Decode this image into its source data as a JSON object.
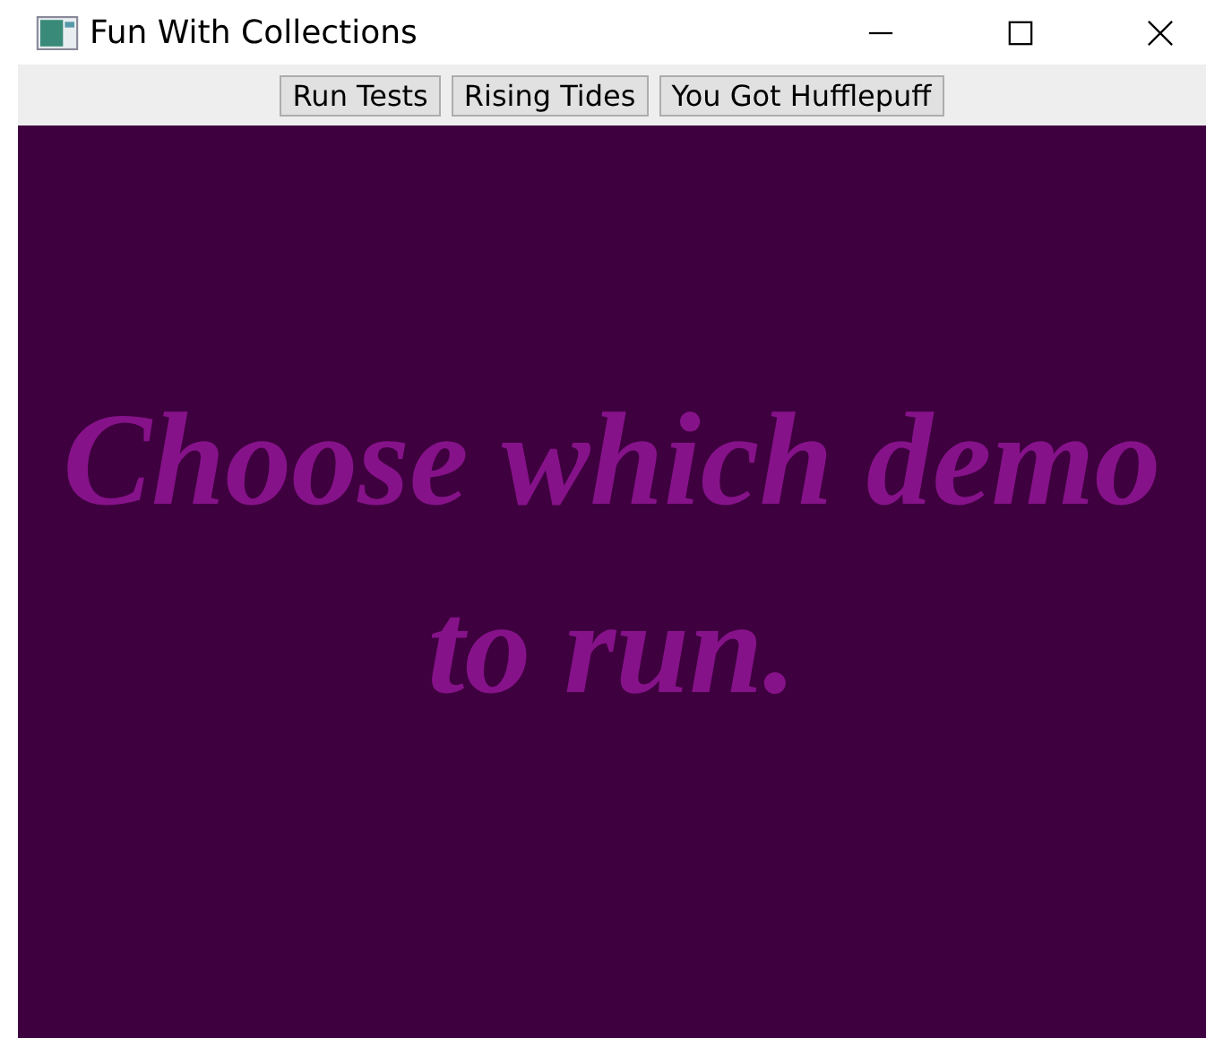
{
  "window": {
    "title": "Fun With Collections"
  },
  "toolbar": {
    "buttons": [
      "Run Tests",
      "Rising Tides",
      "You Got Hufflepuff"
    ]
  },
  "canvas": {
    "message": "Choose which demo to run."
  }
}
